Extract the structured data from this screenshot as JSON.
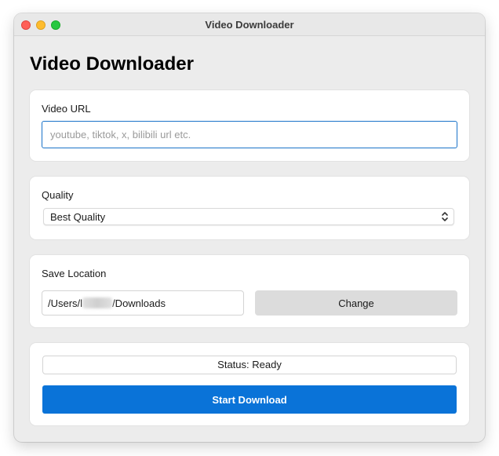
{
  "window": {
    "title": "Video Downloader",
    "controls": [
      "close",
      "minimize",
      "zoom"
    ]
  },
  "page": {
    "title": "Video Downloader"
  },
  "url_section": {
    "label": "Video URL",
    "value": "",
    "placeholder": "youtube, tiktok, x, bilibili url etc."
  },
  "quality_section": {
    "label": "Quality",
    "selected": "Best Quality",
    "icon": "chevron-up-down-icon"
  },
  "save_section": {
    "label": "Save Location",
    "path_prefix": "/Users/",
    "path_visible_fragment": "l",
    "path_suffix": "/Downloads",
    "change_label": "Change"
  },
  "status_section": {
    "status_text": "Status: Ready",
    "start_label": "Start Download"
  },
  "colors": {
    "accent": "#0a73d8",
    "focus_border": "#1a73c9",
    "window_bg": "#ececec",
    "card_bg": "#ffffff",
    "secondary_button_bg": "#dcdcdc"
  }
}
